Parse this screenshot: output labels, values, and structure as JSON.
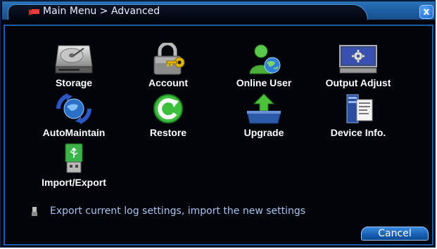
{
  "window": {
    "title": "Main Menu > Advanced",
    "close_label": "x"
  },
  "menu_items": [
    {
      "label": "Storage",
      "icon": "hard-drive-icon"
    },
    {
      "label": "Account",
      "icon": "padlock-key-icon"
    },
    {
      "label": "Online User",
      "icon": "user-globe-icon"
    },
    {
      "label": "Output Adjust",
      "icon": "monitor-gear-icon"
    },
    {
      "label": "AutoMaintain",
      "icon": "globe-cycle-icon"
    },
    {
      "label": "Restore",
      "icon": "restore-arrow-icon"
    },
    {
      "label": "Upgrade",
      "icon": "upgrade-arrow-icon"
    },
    {
      "label": "Device Info.",
      "icon": "server-document-icon"
    },
    {
      "label": "Import/Export",
      "icon": "usb-drive-icon"
    }
  ],
  "hint": {
    "text": "Export current log settings, import the new settings",
    "icon": "usb-small-icon"
  },
  "cancel_label": "Cancel",
  "colors": {
    "background": "#01050d",
    "titlebar": "#1d5ea2",
    "border": "#1b5da6",
    "hint_text": "#a9c4f0"
  }
}
